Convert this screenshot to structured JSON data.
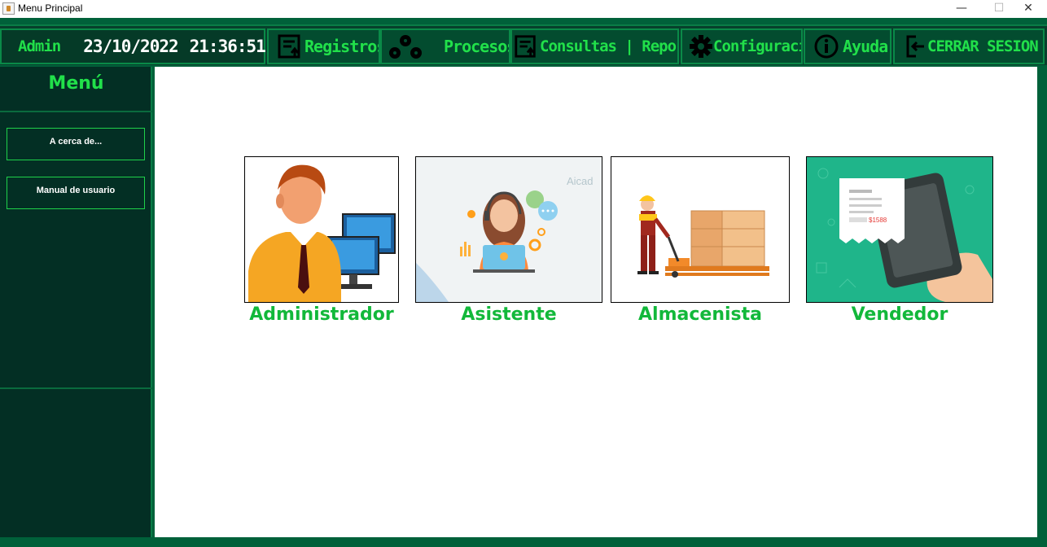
{
  "window": {
    "title": "Menu Principal",
    "minimize": "—",
    "maximize": "☐",
    "close": "✕"
  },
  "header": {
    "user": "Admin",
    "date": "23/10/2022",
    "time": "21:36:51"
  },
  "toolbar": {
    "registros": "Registros",
    "procesos": "Procesos",
    "consultas": "Consultas | Reportes",
    "configuracion": "Configuracióı",
    "ayuda": "Ayuda",
    "cerrar": "CERRAR SESION"
  },
  "sidebar": {
    "title": "Menú",
    "items": [
      {
        "label": "A cerca de..."
      },
      {
        "label": "Manual de usuario"
      }
    ]
  },
  "roles": [
    {
      "label": "Administrador",
      "icon": "administrator-person-computer-icon"
    },
    {
      "label": "Asistente",
      "icon": "assistant-headset-woman-icon"
    },
    {
      "label": "Almacenista",
      "icon": "warehouse-worker-pallet-icon"
    },
    {
      "label": "Vendedor",
      "icon": "phone-receipt-payment-icon"
    }
  ],
  "assistant_watermark": "Aicad",
  "vendor_price": "$1588",
  "colors": {
    "accent_green": "#21e04a",
    "dark_green": "#032f24",
    "frame_green": "#00613a",
    "role_label_green": "#12b83a"
  }
}
